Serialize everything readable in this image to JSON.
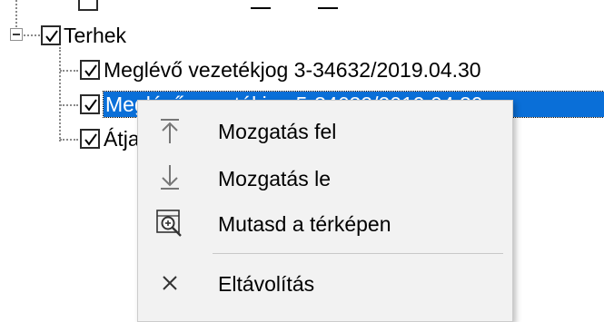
{
  "tree": {
    "root": {
      "label": "Terhek",
      "expanded": true,
      "checked": true
    },
    "children": [
      {
        "label": "Meglévő vezetékjog 3-34632/2019.04.30",
        "checked": true,
        "selected": false
      },
      {
        "label": "Meglévő vezetékjog 5-34632/2019.04.30",
        "checked": true,
        "selected": true
      },
      {
        "label": "Átja",
        "checked": true,
        "selected": false
      }
    ]
  },
  "context_menu": {
    "items": [
      {
        "label": "Mozgatás fel",
        "icon": "arrow-up-icon"
      },
      {
        "label": "Mozgatás le",
        "icon": "arrow-down-icon"
      },
      {
        "label": "Mutasd a térképen",
        "icon": "zoom-map-icon"
      },
      {
        "label": "Eltávolítás",
        "icon": "close-icon"
      }
    ]
  },
  "colors": {
    "selection": "#0a6fd8",
    "menu_bg": "#f2f2f2"
  }
}
